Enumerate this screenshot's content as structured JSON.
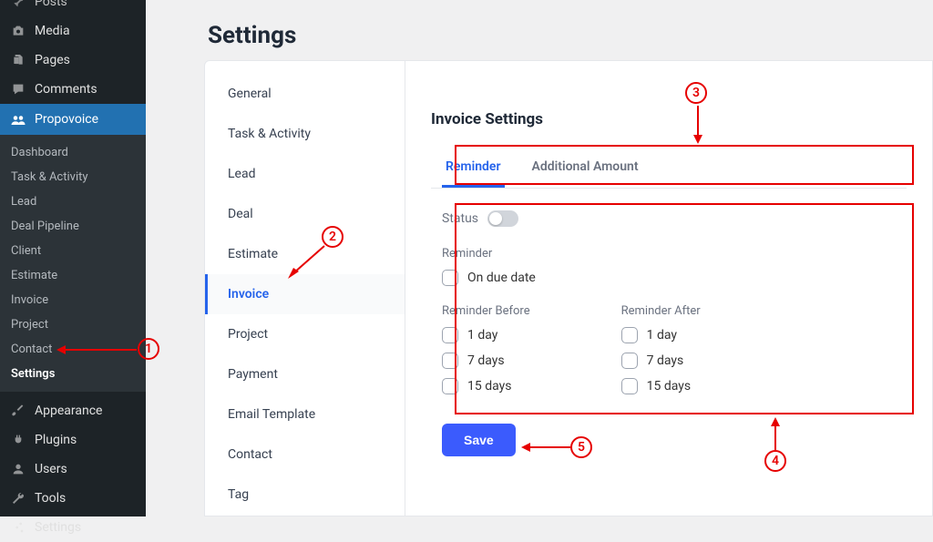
{
  "wp_sidebar": {
    "items": [
      {
        "label": "Posts",
        "icon": "pin"
      },
      {
        "label": "Media",
        "icon": "camera"
      },
      {
        "label": "Pages",
        "icon": "pages"
      },
      {
        "label": "Comments",
        "icon": "comment"
      },
      {
        "label": "Propovoice",
        "icon": "propovoice",
        "active": true
      },
      {
        "label": "Appearance",
        "icon": "brush"
      },
      {
        "label": "Plugins",
        "icon": "plug"
      },
      {
        "label": "Users",
        "icon": "user"
      },
      {
        "label": "Tools",
        "icon": "wrench"
      },
      {
        "label": "Settings",
        "icon": "sliders"
      }
    ],
    "submenu": [
      {
        "label": "Dashboard"
      },
      {
        "label": "Task & Activity"
      },
      {
        "label": "Lead"
      },
      {
        "label": "Deal Pipeline"
      },
      {
        "label": "Client"
      },
      {
        "label": "Estimate"
      },
      {
        "label": "Invoice"
      },
      {
        "label": "Project"
      },
      {
        "label": "Contact"
      },
      {
        "label": "Settings",
        "current": true
      }
    ]
  },
  "page_title": "Settings",
  "settings_nav": [
    {
      "label": "General"
    },
    {
      "label": "Task & Activity"
    },
    {
      "label": "Lead"
    },
    {
      "label": "Deal"
    },
    {
      "label": "Estimate"
    },
    {
      "label": "Invoice",
      "active": true
    },
    {
      "label": "Project"
    },
    {
      "label": "Payment"
    },
    {
      "label": "Email Template"
    },
    {
      "label": "Contact"
    },
    {
      "label": "Tag"
    }
  ],
  "invoice_settings": {
    "title": "Invoice Settings",
    "tabs": [
      {
        "label": "Reminder",
        "active": true
      },
      {
        "label": "Additional Amount"
      }
    ],
    "status_label": "Status",
    "reminder": {
      "label": "Reminder",
      "on_due_date": "On due date"
    },
    "before": {
      "label": "Reminder Before",
      "opts": [
        "1 day",
        "7 days",
        "15 days"
      ]
    },
    "after": {
      "label": "Reminder After",
      "opts": [
        "1 day",
        "7 days",
        "15 days"
      ]
    },
    "save_label": "Save"
  },
  "annotations": {
    "n1": "1",
    "n2": "2",
    "n3": "3",
    "n4": "4",
    "n5": "5"
  }
}
